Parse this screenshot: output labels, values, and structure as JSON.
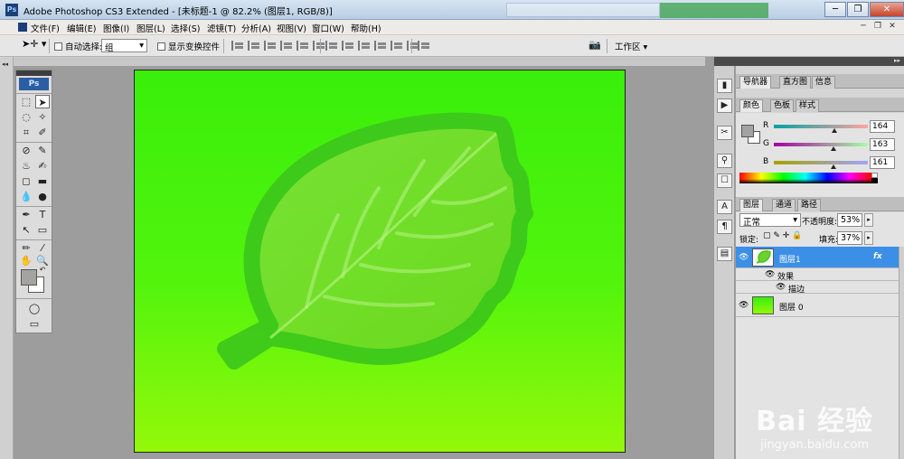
{
  "window": {
    "title": "Adobe Photoshop CS3 Extended - [未标题-1 @ 82.2% (图层1, RGB/8)]",
    "logo": "Ps",
    "buttons": {
      "minimize": "─",
      "restore": "❐",
      "close": "✕"
    }
  },
  "menu": [
    "文件(F)",
    "编辑(E)",
    "图像(I)",
    "图层(L)",
    "选择(S)",
    "滤镜(T)",
    "分析(A)",
    "视图(V)",
    "窗口(W)",
    "帮助(H)"
  ],
  "mdi_buttons": [
    "─",
    "❐",
    "✕"
  ],
  "options_bar": {
    "tool_icon": "move-tool-icon",
    "auto_select_label": "自动选择:",
    "auto_select_value": "组",
    "show_transform_label": "显示变换控件",
    "workspace_label": "工作区 ▾"
  },
  "toolbox": {
    "logo": "Ps",
    "tools": [
      "⬚",
      "➤",
      "◌",
      "✧",
      "⌗",
      "✐",
      "⊘",
      "✎",
      "♨",
      "✍",
      "◻",
      "▬",
      "💧",
      "●",
      "✒",
      "T",
      "↖",
      "▭",
      "✏",
      "⁄",
      "✋",
      "🔍",
      "◯",
      "▭"
    ],
    "colors": {
      "foreground": "#a4a3a1",
      "background": "#ffffff"
    }
  },
  "panels": {
    "group1_tabs": [
      "导航器",
      "直方图",
      "信息"
    ],
    "group2_tabs": [
      "颜色",
      "色板",
      "样式"
    ],
    "color": {
      "rows": [
        {
          "label": "R",
          "value": "164",
          "fraction": 0.643
        },
        {
          "label": "G",
          "value": "163",
          "fraction": 0.639
        },
        {
          "label": "B",
          "value": "161",
          "fraction": 0.631
        }
      ],
      "swatch": "#a4a3a1"
    },
    "group3_tabs": [
      "图层",
      "通道",
      "路径"
    ],
    "layers": {
      "blend_mode": "正常",
      "opacity_label": "不透明度:",
      "opacity_value": "53%",
      "lock_label": "锁定:",
      "fill_label": "填充:",
      "fill_value": "37%",
      "items": [
        {
          "name": "图层1",
          "fx": "fx",
          "selected": true
        },
        {
          "name": "效果",
          "sub": true
        },
        {
          "name": "描边",
          "sub": true
        },
        {
          "name": "图层 0",
          "selected": false
        }
      ]
    }
  },
  "watermark": {
    "brand": "Bai 经验",
    "url": "jingyan.baidu.com"
  }
}
